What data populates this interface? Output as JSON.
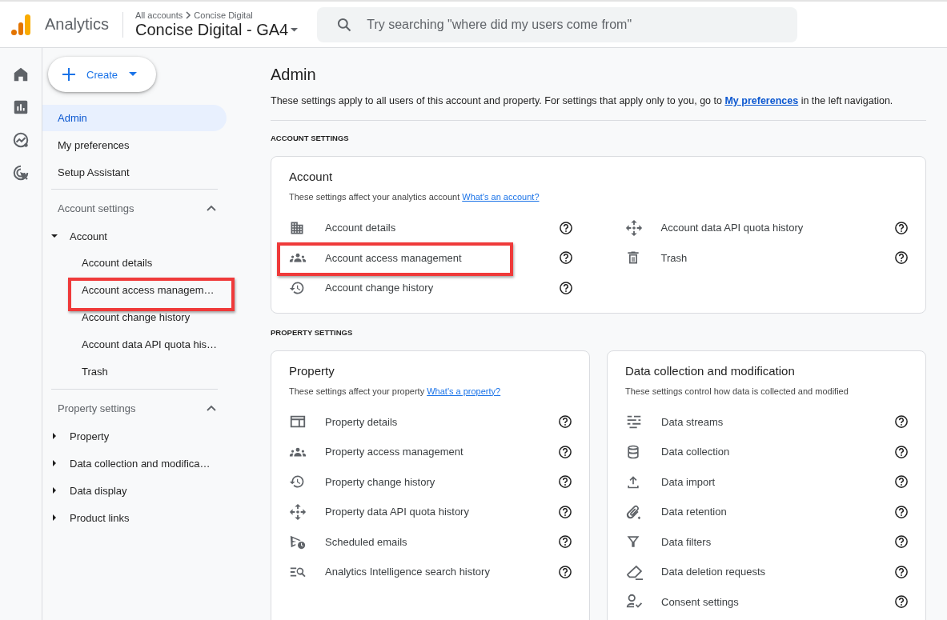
{
  "app": {
    "name": "Analytics"
  },
  "breadcrumb": {
    "parent": "All accounts",
    "current": "Concise Digital"
  },
  "property_selector": {
    "label": "Concise Digital - GA4"
  },
  "search": {
    "placeholder": "Try searching \"where did my users come from\""
  },
  "create_button": {
    "label": "Create"
  },
  "sidebar": {
    "top_items": [
      {
        "label": "Admin",
        "selected": true
      },
      {
        "label": "My preferences",
        "selected": false
      },
      {
        "label": "Setup Assistant",
        "selected": false
      }
    ],
    "sections": [
      {
        "title": "Account settings",
        "expanded": true,
        "groups": [
          {
            "label": "Account",
            "expanded": true,
            "children": [
              {
                "label": "Account details",
                "highlighted": false
              },
              {
                "label": "Account access managem…",
                "highlighted": true
              },
              {
                "label": "Account change history",
                "highlighted": false
              },
              {
                "label": "Account data API quota his…",
                "highlighted": false
              },
              {
                "label": "Trash",
                "highlighted": false
              }
            ]
          }
        ]
      },
      {
        "title": "Property settings",
        "expanded": true,
        "groups": [
          {
            "label": "Property",
            "expanded": false
          },
          {
            "label": "Data collection and modifica…",
            "expanded": false
          },
          {
            "label": "Data display",
            "expanded": false
          },
          {
            "label": "Product links",
            "expanded": false
          }
        ]
      }
    ]
  },
  "main": {
    "title": "Admin",
    "description": {
      "before": "These settings apply to all users of this account and property. For settings that apply only to you, go to",
      "link": "My preferences",
      "after": "in the left navigation."
    },
    "sections": [
      {
        "heading": "ACCOUNT SETTINGS",
        "cards": [
          {
            "title": "Account",
            "description": "These settings affect your analytics account",
            "link": "What's an account?",
            "columns": [
              [
                {
                  "label": "Account details",
                  "highlighted": false
                },
                {
                  "label": "Account access management",
                  "highlighted": true
                },
                {
                  "label": "Account change history",
                  "highlighted": false
                }
              ],
              [
                {
                  "label": "Account data API quota history",
                  "highlighted": false
                },
                {
                  "label": "Trash",
                  "highlighted": false
                }
              ]
            ]
          }
        ]
      },
      {
        "heading": "PROPERTY SETTINGS",
        "cards": [
          {
            "title": "Property",
            "description": "These settings affect your property",
            "link": "What's a property?",
            "columns": [
              [
                {
                  "label": "Property details",
                  "highlighted": false
                },
                {
                  "label": "Property access management",
                  "highlighted": false
                },
                {
                  "label": "Property change history",
                  "highlighted": false
                },
                {
                  "label": "Property data API quota history",
                  "highlighted": false
                },
                {
                  "label": "Scheduled emails",
                  "highlighted": false
                },
                {
                  "label": "Analytics Intelligence search history",
                  "highlighted": false
                }
              ]
            ]
          },
          {
            "title": "Data collection and modification",
            "description": "These settings control how data is collected and modified",
            "columns": [
              [
                {
                  "label": "Data streams",
                  "highlighted": false
                },
                {
                  "label": "Data collection",
                  "highlighted": false
                },
                {
                  "label": "Data import",
                  "highlighted": false
                },
                {
                  "label": "Data retention",
                  "highlighted": false
                },
                {
                  "label": "Data filters",
                  "highlighted": false
                },
                {
                  "label": "Data deletion requests",
                  "highlighted": false
                },
                {
                  "label": "Consent settings",
                  "highlighted": false
                }
              ]
            ]
          }
        ]
      }
    ]
  }
}
